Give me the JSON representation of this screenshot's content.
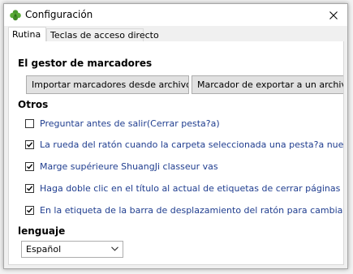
{
  "window": {
    "title": "Configuración",
    "icon": "clover-icon",
    "close_icon": "close-icon"
  },
  "tabs": [
    {
      "label": "Rutina",
      "active": true
    },
    {
      "label": "Teclas de acceso directo",
      "active": false
    }
  ],
  "bookmarks": {
    "heading": "El gestor de marcadores",
    "import_label": "Importar marcadores desde archivo html...",
    "export_label": "Marcador de exportar a un archivo html..."
  },
  "others": {
    "heading": "Otros",
    "options": [
      {
        "label": "Preguntar antes de salir(Cerrar pesta?a)",
        "checked": false
      },
      {
        "label": "La rueda del ratón cuando la carpeta seleccionada una pesta?a nueva",
        "checked": true
      },
      {
        "label": "Marge supérieure ShuangJi classeur vas",
        "checked": true
      },
      {
        "label": "Haga doble clic en el título al actual de etiquetas de cerrar páginas de etiquetado",
        "checked": true
      },
      {
        "label": "En la etiqueta de la barra de desplazamiento del ratón para cambiar las etiquetas página",
        "checked": true
      }
    ]
  },
  "language": {
    "heading": "lenguaje",
    "selected": "Español"
  },
  "colors": {
    "link_text": "#1f3d8f",
    "icon_green": "#4a9a2e"
  }
}
